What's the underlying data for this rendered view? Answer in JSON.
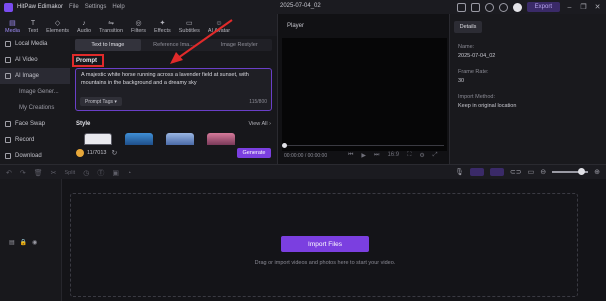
{
  "app": {
    "name": "HitPaw Edimakor",
    "menu": [
      "File",
      "Settings",
      "Help"
    ],
    "document_title": "2025-07-04_02",
    "export_label": "Export"
  },
  "toolbar": {
    "tools": [
      {
        "label": "Media",
        "icon": "media-icon",
        "glyph": "▤"
      },
      {
        "label": "Text",
        "icon": "text-icon",
        "glyph": "T"
      },
      {
        "label": "Elements",
        "icon": "elements-icon",
        "glyph": "◇"
      },
      {
        "label": "Audio",
        "icon": "audio-icon",
        "glyph": "♪"
      },
      {
        "label": "Transition",
        "icon": "transition-icon",
        "glyph": "⇋"
      },
      {
        "label": "Filters",
        "icon": "filters-icon",
        "glyph": "◎"
      },
      {
        "label": "Effects",
        "icon": "effects-icon",
        "glyph": "✦"
      },
      {
        "label": "Subtitles",
        "icon": "subtitles-icon",
        "glyph": "▭"
      },
      {
        "label": "AI Avatar",
        "icon": "ai-avatar-icon",
        "glyph": "☺"
      }
    ]
  },
  "sidebar": {
    "items": [
      {
        "label": "Local Media"
      },
      {
        "label": "AI Video"
      },
      {
        "label": "AI Image"
      },
      {
        "label": "Image Gener..."
      },
      {
        "label": "My Creations"
      },
      {
        "label": "Face Swap"
      },
      {
        "label": "Record"
      },
      {
        "label": "Download"
      }
    ]
  },
  "ai_image": {
    "tabs": [
      "Text to Image",
      "Reference Ima...",
      "Image Restyler"
    ],
    "prompt_label": "Prompt",
    "prompt_text": "A majestic white horse running across a lavender field at sunset, with mountains in the background and a dreamy sky",
    "prompt_tags_label": "Prompt Tags",
    "char_count": "115/800",
    "style_label": "Style",
    "view_all_label": "View All",
    "credits": "11/7013",
    "generate_label": "Generate"
  },
  "player": {
    "title": "Player",
    "time": "00:00:00 / 00:00:00",
    "controls": [
      "⏮",
      "▶",
      "⏭",
      "16:9",
      "⛶",
      "⚙",
      "⤢"
    ]
  },
  "details": {
    "tab": "Details",
    "name_label": "Name:",
    "name_value": "2025-07-04_02",
    "frame_rate_label": "Frame Rate:",
    "frame_rate_value": "30",
    "import_method_label": "Import Method:",
    "import_method_value": "Keep in original location"
  },
  "timeline": {
    "split_label": "Split",
    "import_files_label": "Import Files",
    "drop_hint": "Drag or import videos and photos here to start your video."
  },
  "colors": {
    "accent": "#7b3fe0",
    "highlight": "#e02a2a"
  }
}
